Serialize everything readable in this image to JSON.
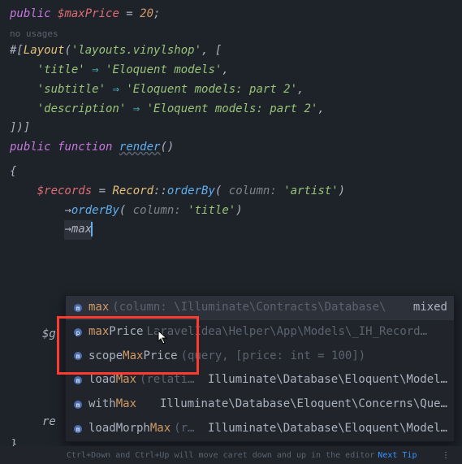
{
  "lines": {
    "l1_public": "public",
    "l1_var": "$maxPrice",
    "l1_eq": " = ",
    "l1_num": "20",
    "l1_semi": ";",
    "usages": "no usages",
    "attr_hash": "#[",
    "attr_name": "Layout",
    "attr_open": "(",
    "attr_str": "'layouts.vinylshop'",
    "attr_comma": ", [",
    "arr1_key": "'title'",
    "arr1_arrow": " ⇒ ",
    "arr1_val": "'Eloquent models'",
    "arr2_key": "'subtitle'",
    "arr2_arrow": " ⇒ ",
    "arr2_val": "'Eloquent models: part 2'",
    "arr3_key": "'description'",
    "arr3_arrow": " ⇒ ",
    "arr3_val": "'Eloquent models: part 2'",
    "attr_close": "])]",
    "fn_public": "public",
    "fn_function": "function",
    "fn_name": "render",
    "fn_parens": "()",
    "brace_open": "{",
    "rec_var": "$records",
    "rec_eq": " = ",
    "rec_class": "Record",
    "rec_dbl": "::",
    "rec_ob": "orderBy",
    "rec_open": "(",
    "rec_hint": " column: ",
    "rec_arg": "'artist'",
    "rec_close": ")",
    "ob2_arrow": "→",
    "ob2_name": "orderBy",
    "ob2_open": "(",
    "ob2_hint": " column: ",
    "ob2_arg": "'title'",
    "ob2_close": ")",
    "typed_arrow": "→",
    "typed_text": "max",
    "under_g": "$g",
    "under_re": "re",
    "brace_close": "}"
  },
  "popup": {
    "items": [
      {
        "name": "max",
        "m": "max",
        "suffix": "",
        "hint": "(column: \\Illuminate\\Contracts\\Database\\",
        "right": "mixed"
      },
      {
        "name": "maxPrice",
        "m": "max",
        "suffix": "Price",
        "hint": "LaravelIdea\\Helper\\App\\Models\\_IH_Record…",
        "right": ""
      },
      {
        "name": "scopeMaxPrice",
        "pre": "scope",
        "m": "Max",
        "suffix": "Price",
        "hint": "(query, [price: int = 100])",
        "right": ""
      },
      {
        "name": "loadMax",
        "pre": "load",
        "m": "Max",
        "suffix": "",
        "hint": "(relati…",
        "right": "Illuminate\\Database\\Eloquent\\Model…"
      },
      {
        "name": "withMax",
        "pre": "with",
        "m": "Max",
        "suffix": "",
        "hint": "",
        "right": "Illuminate\\Database\\Eloquent\\Concerns\\Que…"
      },
      {
        "name": "loadMorphMax",
        "pre": "loadMorph",
        "m": "Max",
        "suffix": "",
        "hint": "(r…",
        "right": "Illuminate\\Database\\Eloquent\\Model…"
      }
    ]
  },
  "status": {
    "text": "Ctrl+Down and Ctrl+Up will move caret down and up in the editor",
    "link": "Next Tip",
    "menu": "⋮"
  }
}
